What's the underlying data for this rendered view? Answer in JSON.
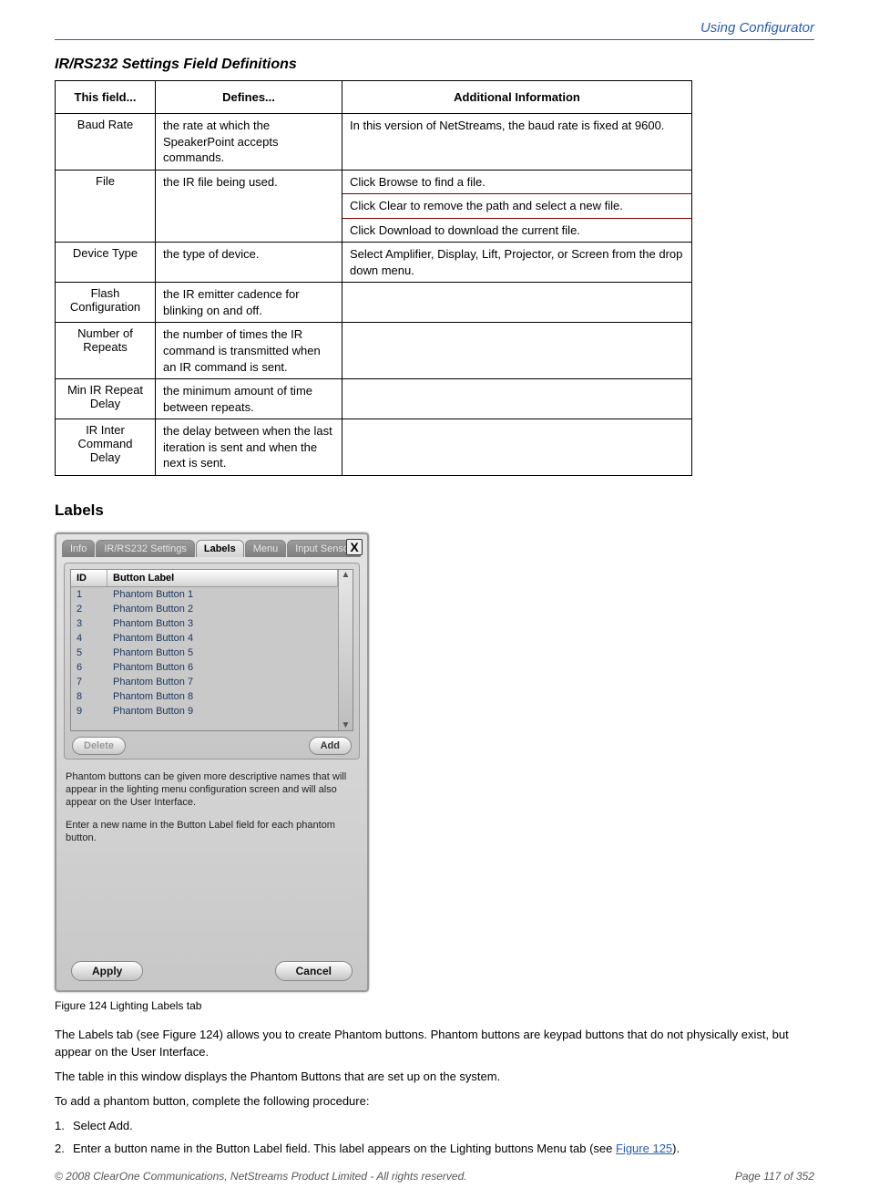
{
  "header": {
    "right_title": "Using Configurator"
  },
  "section_title": "IR/RS232 Settings Field Definitions",
  "ref_table": {
    "head": [
      "This field...",
      "Defines...",
      "Additional Information"
    ],
    "rows": [
      {
        "c0": "Baud Rate",
        "c1": "the rate at which the SpeakerPoint accepts commands.",
        "c2": "In this version of NetStreams, the baud rate is fixed at 9600."
      },
      {
        "c0": "File",
        "c1": "the IR file being used.",
        "c2": {
          "multi": [
            "Click Browse to find a file.",
            "Click Clear to remove the path and select a new file.",
            "Click Download to download the current file."
          ]
        }
      },
      {
        "c0": "Device Type",
        "c1": "the type of device.",
        "c2": "Select Amplifier, Display, Lift, Projector, or Screen from the drop down menu."
      },
      {
        "c0": "Flash Configuration",
        "c1": "the IR emitter cadence for blinking on and off.",
        "c2": ""
      },
      {
        "c0": "Number of Repeats",
        "c1": "the number of times the IR command is transmitted when an IR command is sent.",
        "c2": ""
      },
      {
        "c0": "Min IR Repeat Delay",
        "c1": "the minimum amount of time between repeats.",
        "c2": ""
      },
      {
        "c0": "IR Inter Command Delay",
        "c1": "the delay between when the last iteration is sent and when the next is sent.",
        "c2": ""
      }
    ]
  },
  "labels_heading": "Labels",
  "dialog": {
    "tabs": [
      "Info",
      "IR/RS232 Settings",
      "Labels",
      "Menu",
      "Input Sensor"
    ],
    "active_tab": "Labels",
    "close": "X",
    "grid_head": {
      "id": "ID",
      "label": "Button Label"
    },
    "rows": [
      {
        "id": "1",
        "label": "Phantom Button 1"
      },
      {
        "id": "2",
        "label": "Phantom Button 2"
      },
      {
        "id": "3",
        "label": "Phantom Button 3"
      },
      {
        "id": "4",
        "label": "Phantom Button 4"
      },
      {
        "id": "5",
        "label": "Phantom Button 5"
      },
      {
        "id": "6",
        "label": "Phantom Button 6"
      },
      {
        "id": "7",
        "label": "Phantom Button 7"
      },
      {
        "id": "8",
        "label": "Phantom Button 8"
      },
      {
        "id": "9",
        "label": "Phantom Button 9"
      }
    ],
    "scroll_up": "▲",
    "scroll_down": "▼",
    "delete_btn": "Delete",
    "add_btn": "Add",
    "desc1": "Phantom buttons can be given more descriptive names that will appear in the lighting menu configuration screen and will also appear on the User Interface.",
    "desc2": "Enter a new name in the Button Label field for each phantom button.",
    "apply_btn": "Apply",
    "cancel_btn": "Cancel"
  },
  "figure_caption": "Figure 124  Lighting Labels tab",
  "body_para1": "The Labels tab (see Figure 124) allows you to create Phantom buttons. Phantom buttons are keypad buttons that do not physically exist, but appear on the User Interface.",
  "body_para2": "The table in this window displays the Phantom Buttons that are set up on the system.",
  "body_para3": "To add a phantom button, complete the following procedure:",
  "steps": {
    "s1": "Select Add.",
    "s2_pre": "Enter a button name in the Button Label field. This label appears on the Lighting buttons Menu tab (see ",
    "s2_link": "Figure 125",
    "s2_post": ")."
  },
  "footer": {
    "left": "© 2008 ClearOne Communications, NetStreams Product Limited - All rights reserved.",
    "right": "Page 117 of 352"
  }
}
